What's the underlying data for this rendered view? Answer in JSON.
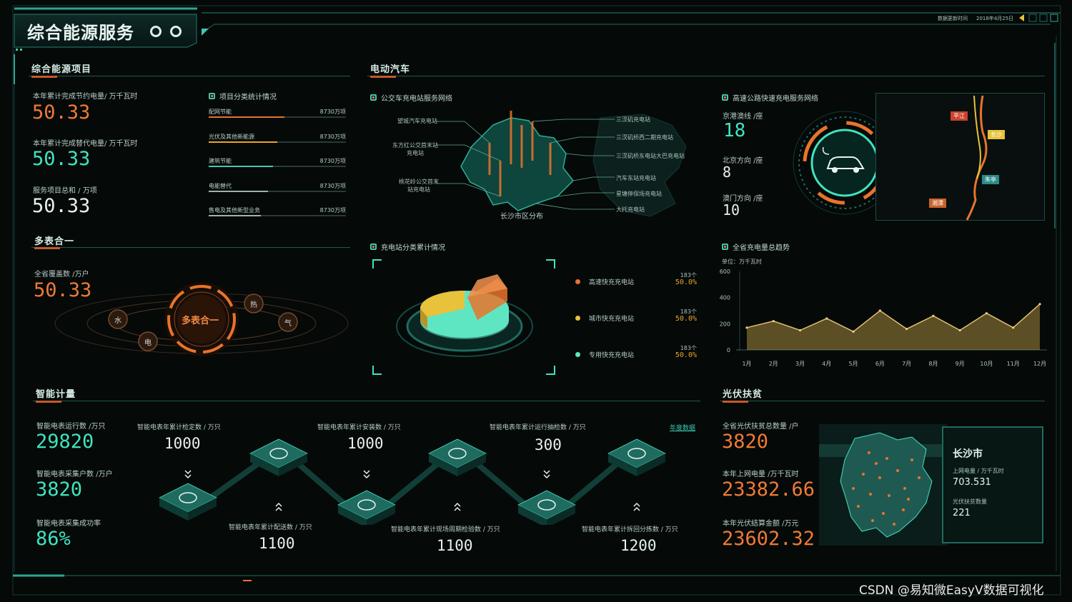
{
  "header": {
    "title": "综合能源服务",
    "update_label": "数据更新时间",
    "update_date": "2018年4月25日"
  },
  "project": {
    "title": "综合能源项目",
    "stats": [
      {
        "label": "本年累计完成节约电量/ 万千瓦时",
        "value": "50.33"
      },
      {
        "label": "本年累计完成替代电量/ 万千瓦时",
        "value": "50.33"
      },
      {
        "label": "服务项目总和 / 万项",
        "value": "50.33"
      }
    ],
    "category_title": "项目分类统计情况",
    "categories": [
      {
        "name": "配网节能",
        "value": "8730万项",
        "fill": 0.55,
        "color": "#e8742c"
      },
      {
        "name": "光伏及其他新能源",
        "value": "8730万项",
        "fill": 0.5,
        "color": "#e8a628"
      },
      {
        "name": "建筑节能",
        "value": "8730万项",
        "fill": 0.47,
        "color": "#3ec9b1"
      },
      {
        "name": "电能替代",
        "value": "8730万项",
        "fill": 0.43,
        "color": "#9fb3ae"
      },
      {
        "name": "售电及其他新型业务",
        "value": "8730万项",
        "fill": 0.38,
        "color": "#9fb3ae"
      }
    ]
  },
  "multi": {
    "title": "多表合一",
    "label": "全省覆盖数 /万户",
    "value": "50.33",
    "center": "多表合一",
    "nodes": [
      "水",
      "电",
      "热",
      "气"
    ]
  },
  "ev": {
    "title": "电动汽车",
    "bus_title": "公交车充电站服务网络",
    "map_caption": "长沙市区分布",
    "stations_left": [
      "望城汽车充电站",
      "东方红公交首末站充电站",
      "桃花岭公交首末站充电站"
    ],
    "stations_right": [
      "三汊矶充电站",
      "三汊矶桥西二期充电站",
      "三汊矶桥东电站大巴充电站",
      "汽车东站充电站",
      "星塘停保场充电站",
      "大托充电站"
    ],
    "highway_title": "高速公路快速充电服务网络",
    "highway": [
      {
        "label": "京港澳线 /座",
        "value": "18"
      },
      {
        "label": "北京方向 /座",
        "value": "8"
      },
      {
        "label": "澳门方向 /座",
        "value": "10"
      }
    ],
    "route_tags": [
      "平江",
      "长沙",
      "朱亭",
      "湘潭"
    ],
    "pie_title": "充电站分类累计情况",
    "pie_legend": [
      {
        "name": "高速快充充电站",
        "count": "183个",
        "pct": "50.0%",
        "color": "#e8742c"
      },
      {
        "name": "城市快充充电站",
        "count": "183个",
        "pct": "50.0%",
        "color": "#e8c23a"
      },
      {
        "name": "专用快充充电站",
        "count": "183个",
        "pct": "50.0%",
        "color": "#5ee6c3"
      }
    ],
    "trend_title": "全省充电量总趋势",
    "trend_unit": "单位：万千瓦时"
  },
  "chart_data": {
    "type": "area",
    "title": "全省充电量总趋势",
    "ylabel": "单位：万千瓦时",
    "categories": [
      "1月",
      "2月",
      "3月",
      "4月",
      "5月",
      "6月",
      "7月",
      "8月",
      "9月",
      "10月",
      "11月",
      "12月"
    ],
    "values": [
      170,
      220,
      150,
      240,
      140,
      300,
      160,
      260,
      150,
      280,
      170,
      350
    ],
    "ylim": [
      0,
      600
    ],
    "yticks": [
      "600",
      "400",
      "200",
      "0"
    ],
    "color": "#c8a44a"
  },
  "meter": {
    "title": "智能计量",
    "link": "年度数据",
    "left": [
      {
        "label": "智能电表运行数 /万只",
        "value": "29820"
      },
      {
        "label": "智能电表采集户数 /万户",
        "value": "3820"
      },
      {
        "label": "智能电表采集成功率",
        "value": "86%"
      }
    ],
    "top": [
      {
        "label": "智能电表年累计检定数 / 万只",
        "value": "1000"
      },
      {
        "label": "智能电表年累计安装数 / 万只",
        "value": "1000"
      },
      {
        "label": "智能电表年累计运行抽检数 / 万只",
        "value": "300"
      }
    ],
    "bottom": [
      {
        "label": "智能电表年累计配送数 / 万只",
        "value": "1100"
      },
      {
        "label": "智能电表年累计现场周期检验数 / 万只",
        "value": "1100"
      },
      {
        "label": "智能电表年累计拆回分拣数 / 万只",
        "value": "1200"
      }
    ]
  },
  "pv": {
    "title": "光伏扶贫",
    "stats": [
      {
        "label": "全省光伏扶贫总数量 /户",
        "value": "3820"
      },
      {
        "label": "本年上网电量 /万千瓦时",
        "value": "23382.66"
      },
      {
        "label": "本年光伏结算金额 /万元",
        "value": "23602.32"
      }
    ],
    "city": "长沙市",
    "city_label1": "上网电量 / 万千瓦时",
    "city_value1": "703.531",
    "city_label2": "光伏扶贫数量",
    "city_value2": "221"
  },
  "watermark": "CSDN @易知微EasyV数据可视化"
}
